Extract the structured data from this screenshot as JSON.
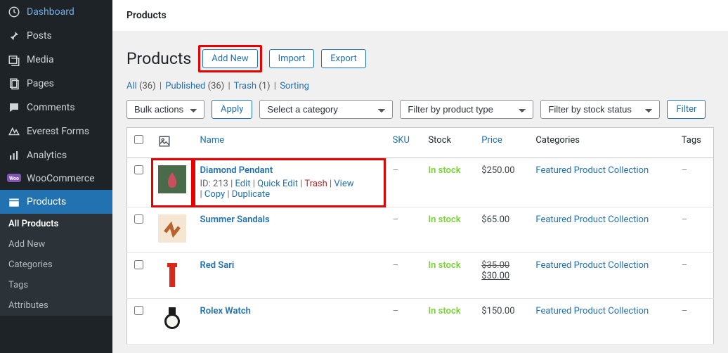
{
  "sidebar": {
    "items": [
      {
        "label": "Dashboard",
        "icon": "dashboard"
      },
      {
        "label": "Posts",
        "icon": "pin"
      },
      {
        "label": "Media",
        "icon": "media"
      },
      {
        "label": "Pages",
        "icon": "pages"
      },
      {
        "label": "Comments",
        "icon": "comments"
      },
      {
        "label": "Everest Forms",
        "icon": "forms"
      },
      {
        "label": "Analytics",
        "icon": "analytics"
      },
      {
        "label": "WooCommerce",
        "icon": "woo"
      },
      {
        "label": "Products",
        "icon": "products"
      }
    ],
    "sub": [
      {
        "label": "All Products",
        "active": true
      },
      {
        "label": "Add New"
      },
      {
        "label": "Categories"
      },
      {
        "label": "Tags"
      },
      {
        "label": "Attributes"
      }
    ]
  },
  "topbar": {
    "title": "Products"
  },
  "header": {
    "title": "Products",
    "add_new": "Add New",
    "import": "Import",
    "export": "Export"
  },
  "status_links": {
    "all": "All",
    "all_count": "(36)",
    "published": "Published",
    "published_count": "(36)",
    "trash": "Trash",
    "trash_count": "(1)",
    "sorting": "Sorting"
  },
  "filters": {
    "bulk": "Bulk actions",
    "apply": "Apply",
    "category": "Select a category",
    "ptype": "Filter by product type",
    "stock": "Filter by stock status",
    "filter": "Filter"
  },
  "table": {
    "head": {
      "name": "Name",
      "sku": "SKU",
      "stock": "Stock",
      "price": "Price",
      "categories": "Categories",
      "tags": "Tags"
    },
    "rows": [
      {
        "name": "Diamond Pendant",
        "id": "ID: 213",
        "sku": "–",
        "stock": "In stock",
        "price": "$250.00",
        "categories": "Featured Product Collection",
        "tags": "–",
        "actions": {
          "edit": "Edit",
          "quick": "Quick Edit",
          "trash": "Trash",
          "view": "View",
          "copy": "Copy",
          "dup": "Duplicate"
        }
      },
      {
        "name": "Summer Sandals",
        "sku": "–",
        "stock": "In stock",
        "price": "$65.00",
        "categories": "Featured Product Collection",
        "tags": "–"
      },
      {
        "name": "Red Sari",
        "sku": "–",
        "stock": "In stock",
        "price_old": "$35.00",
        "price_new": "$30.00",
        "categories": "Featured Product Collection",
        "tags": "–"
      },
      {
        "name": "Rolex Watch",
        "sku": "–",
        "stock": "In stock",
        "price": "$150.00",
        "categories": "Featured Product Collection",
        "tags": "–"
      }
    ]
  }
}
